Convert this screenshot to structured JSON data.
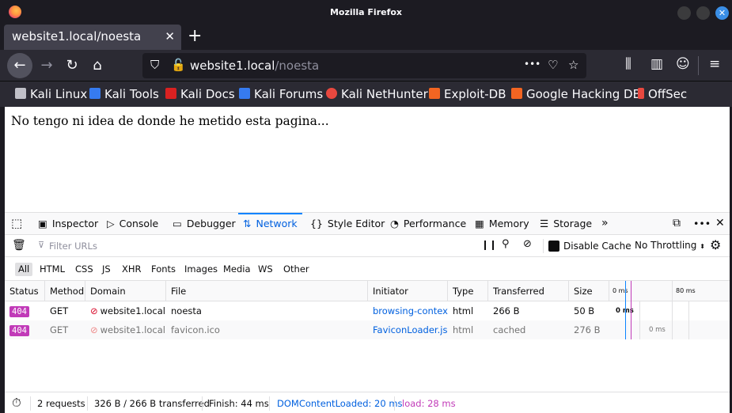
{
  "window": {
    "title": "Mozilla Firefox"
  },
  "tab": {
    "title": "website1.local/noesta",
    "close": "✕"
  },
  "navbar": {
    "url_host": "website1.local",
    "url_path": "/noesta",
    "more": "•••"
  },
  "bookmarks": [
    {
      "label": "Kali Linux",
      "color": "#367bf0"
    },
    {
      "label": "Kali Tools",
      "color": "#e8483f"
    },
    {
      "label": "Kali Docs",
      "color": "#d92121"
    },
    {
      "label": "Kali Forums",
      "color": "#367bf0"
    },
    {
      "label": "Kali NetHunter",
      "color": "#e8483f"
    },
    {
      "label": "Exploit-DB",
      "color": "#f26522"
    },
    {
      "label": "Google Hacking DB",
      "color": "#f26522"
    },
    {
      "label": "OffSec",
      "color": "#e8483f"
    }
  ],
  "page": {
    "body_text": "No tengo ni idea de donde he metido esta pagina..."
  },
  "devtools": {
    "tabs": [
      "Inspector",
      "Console",
      "Debugger",
      "Network",
      "Style Editor",
      "Performance",
      "Memory",
      "Storage"
    ],
    "active_tab": "Network",
    "filter_placeholder": "Filter URLs",
    "disable_cache": "Disable Cache",
    "throttling": "No Throttling",
    "types": [
      "All",
      "HTML",
      "CSS",
      "JS",
      "XHR",
      "Fonts",
      "Images",
      "Media",
      "WS",
      "Other"
    ],
    "columns": [
      "Status",
      "Method",
      "Domain",
      "File",
      "Initiator",
      "Type",
      "Transferred",
      "Size"
    ],
    "timeline_labels": [
      "0 ms",
      "80 ms"
    ],
    "requests": [
      {
        "status": "404",
        "method": "GET",
        "domain": "website1.local",
        "file": "noesta",
        "initiator": "browsing-contex...",
        "type": "html",
        "transferred": "266 B",
        "size": "50 B",
        "time": "0 ms"
      },
      {
        "status": "404",
        "method": "GET",
        "domain": "website1.local",
        "file": "favicon.ico",
        "initiator": "FaviconLoader.js...",
        "type": "html",
        "transferred": "cached",
        "size": "276 B",
        "time": "0 ms"
      }
    ],
    "summary": {
      "requests": "2 requests",
      "transferred": "326 B / 266 B transferred",
      "finish": "Finish: 44 ms",
      "dom": "DOMContentLoaded: 20 ms",
      "load": "load: 28 ms"
    }
  }
}
